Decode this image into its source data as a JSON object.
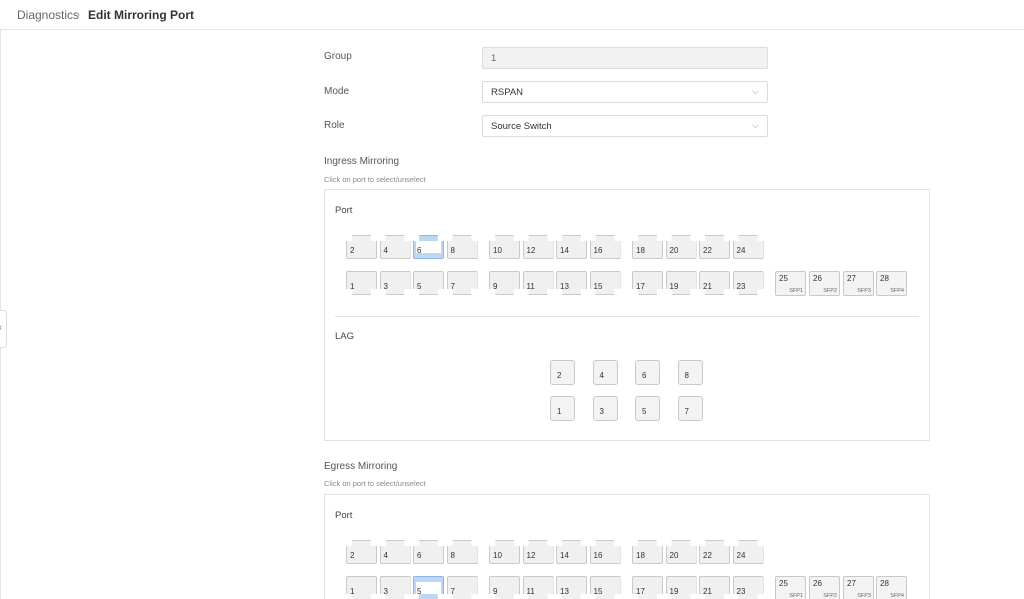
{
  "breadcrumb": {
    "parent": "Diagnostics",
    "separator": "›",
    "current": "Edit Mirroring Port"
  },
  "form": {
    "group": {
      "label": "Group",
      "value": "1"
    },
    "mode": {
      "label": "Mode",
      "value": "RSPAN"
    },
    "role": {
      "label": "Role",
      "value": "Source Switch"
    }
  },
  "ingress": {
    "title": "Ingress Mirroring",
    "hint": "Click on port to select/unselect",
    "port_label": "Port",
    "lag_label": "LAG",
    "selected_ports": [
      "6"
    ]
  },
  "egress": {
    "title": "Egress Mirroring",
    "hint": "Click on port to select/unselect",
    "port_label": "Port",
    "selected_ports": [
      "5"
    ]
  },
  "port_groups": [
    {
      "top": [
        "2",
        "4",
        "6",
        "8"
      ],
      "bottom": [
        "1",
        "3",
        "5",
        "7"
      ]
    },
    {
      "top": [
        "10",
        "12",
        "14",
        "16"
      ],
      "bottom": [
        "9",
        "11",
        "13",
        "15"
      ]
    },
    {
      "top": [
        "18",
        "20",
        "22",
        "24"
      ],
      "bottom": [
        "17",
        "19",
        "21",
        "23"
      ]
    }
  ],
  "sfp_ports": [
    {
      "num": "25",
      "sub": "SFP1"
    },
    {
      "num": "26",
      "sub": "SFP2"
    },
    {
      "num": "27",
      "sub": "SFP3"
    },
    {
      "num": "28",
      "sub": "SFP4"
    }
  ],
  "lags": {
    "top": [
      "2",
      "4",
      "6",
      "8"
    ],
    "bottom": [
      "1",
      "3",
      "5",
      "7"
    ]
  },
  "colors": {
    "selected_port": "#bcd6f3",
    "port": "#f0f0f0",
    "border": "#c9c9c9"
  },
  "icons": {
    "chevron": "chevron-down-icon",
    "breadcrumb_separator": "chevron-right-icon",
    "collapse": "chevron-left-icon"
  }
}
